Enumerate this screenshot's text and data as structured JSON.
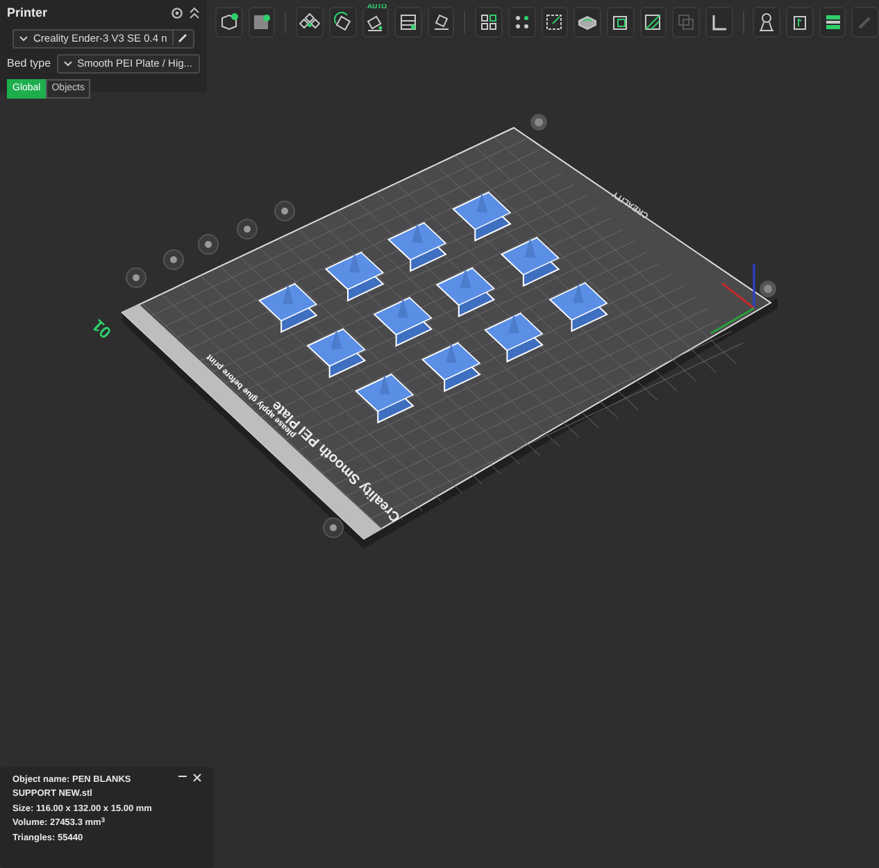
{
  "printer_panel": {
    "title": "Printer",
    "printer": "Creality Ender-3 V3 SE 0.4 n",
    "bed_type_label": "Bed type",
    "bed_type": "Smooth PEI Plate / Hig...",
    "tabs": [
      {
        "label": "Global",
        "selected": true
      },
      {
        "label": "Objects",
        "selected": false
      }
    ]
  },
  "toolbar": {
    "auto_label": "AUTO"
  },
  "plate": {
    "number": "01",
    "brand": "CREALITY",
    "name": "Creality Smooth PEI Plate",
    "note": "please apply glue before print"
  },
  "object_info": {
    "lines": [
      "Object name: PEN BLANKS SUPPORT NEW.stl",
      "Size: 116.00 x 132.00 x 15.00 mm",
      "Volume: 27453.3 mm$^{3}$",
      "Triangles: 55440"
    ]
  }
}
